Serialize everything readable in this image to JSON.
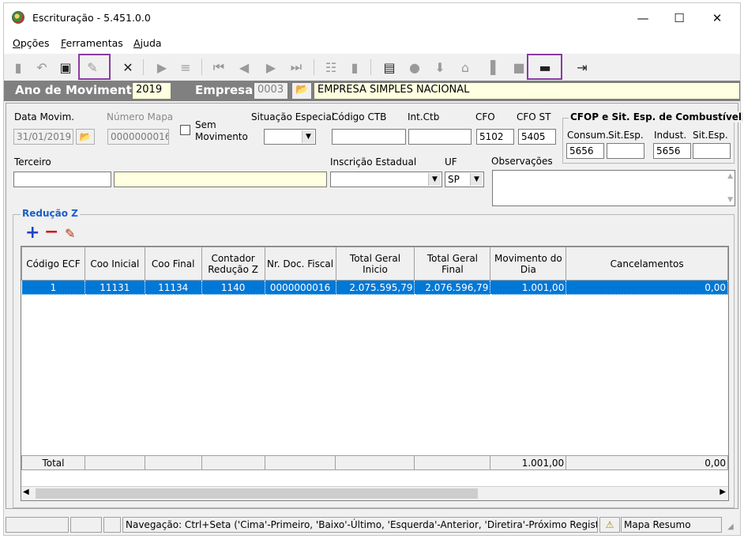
{
  "window": {
    "title": "Escrituração - 5.451.0.0",
    "minimize": "—",
    "maximize": "☐",
    "close": "✕"
  },
  "menu": [
    {
      "accel": "O",
      "rest": "pções"
    },
    {
      "accel": "F",
      "rest": "erramentas"
    },
    {
      "accel": "A",
      "rest": "juda"
    }
  ],
  "header": {
    "ano_label": "Ano de Movimento",
    "ano_value": "2019",
    "empresa_label": "Empresa",
    "empresa_code": "0003",
    "empresa_name": "EMPRESA SIMPLES NACIONAL"
  },
  "form": {
    "data_movim_label": "Data Movim.",
    "data_movim_value": "31/01/2019",
    "numero_mapa_label": "Número Mapa",
    "numero_mapa_value": "0000000016",
    "sem_movimento_label_1": "Sem",
    "sem_movimento_label_2": "Movimento",
    "situacao_label": "Situação Especial",
    "situacao_value": "",
    "codigo_ctb_label": "Código CTB",
    "codigo_ctb_value": "",
    "int_ctb_label": "Int.Ctb",
    "int_ctb_value": "",
    "cfo_label": "CFO",
    "cfo_value": "5102",
    "cfo_st_label": "CFO ST",
    "cfo_st_value": "5405",
    "cfop_group_title": "CFOP e Sit. Esp. de Combustível",
    "consum_label": "Consum.",
    "consum_value": "5656",
    "sitesp1_label": "Sit.Esp.",
    "sitesp1_value": "",
    "indust_label": "Indust.",
    "indust_value": "5656",
    "sitesp2_label": "Sit.Esp.",
    "sitesp2_value": "",
    "terceiro_label": "Terceiro",
    "terceiro_code": "",
    "terceiro_name": "",
    "ie_label": "Inscrição Estadual",
    "ie_value": "",
    "uf_label": "UF",
    "uf_value": "SP",
    "obs_label": "Observações",
    "obs_value": ""
  },
  "reducao": {
    "title": "Redução Z",
    "columns": [
      "Código ECF",
      "Coo Inicial",
      "Coo Final",
      "Contador Redução Z",
      "Nr. Doc. Fiscal",
      "Total Geral Inicio",
      "Total Geral Final",
      "Movimento do Dia",
      "Cancelamentos"
    ],
    "rows": [
      [
        "1",
        "11131",
        "11134",
        "1140",
        "0000000016",
        "2.075.595,79",
        "2.076.596,79",
        "1.001,00",
        "0,00"
      ]
    ],
    "totals": [
      "Total",
      "",
      "",
      "",
      "",
      "",
      "",
      "1.001,00",
      "0,00"
    ]
  },
  "status": {
    "navegacao": "Navegação: Ctrl+Seta ('Cima'-Primeiro, 'Baixo'-Último, 'Esquerda'-Anterior, 'Diretira'-Próximo Registro)",
    "mapa": "Mapa Resumo"
  }
}
